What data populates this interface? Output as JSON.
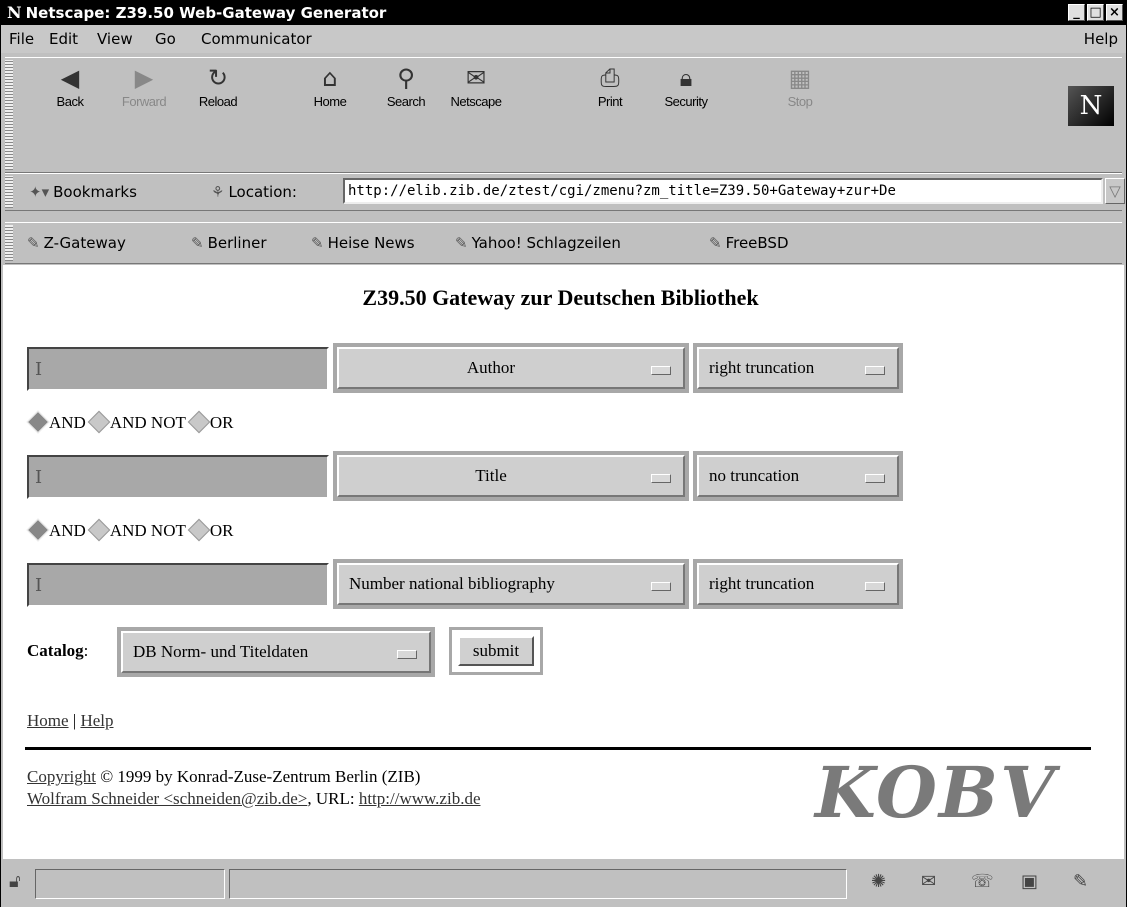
{
  "window": {
    "title": "Netscape: Z39.50 Web-Gateway Generator",
    "logo_letter": "N"
  },
  "menu": {
    "items": [
      "File",
      "Edit",
      "View",
      "Go",
      "Communicator"
    ],
    "help": "Help"
  },
  "nav": {
    "buttons": [
      {
        "label": "Back",
        "icon": "back-arrow-icon",
        "enabled": true
      },
      {
        "label": "Forward",
        "icon": "forward-arrow-icon",
        "enabled": false
      },
      {
        "label": "Reload",
        "icon": "reload-icon",
        "enabled": true
      },
      {
        "label": "Home",
        "icon": "home-icon",
        "enabled": true
      },
      {
        "label": "Search",
        "icon": "search-icon",
        "enabled": true
      },
      {
        "label": "Netscape",
        "icon": "netscape-icon",
        "enabled": true
      },
      {
        "label": "Print",
        "icon": "printer-icon",
        "enabled": true
      },
      {
        "label": "Security",
        "icon": "lock-icon",
        "enabled": true
      },
      {
        "label": "Stop",
        "icon": "stop-icon",
        "enabled": false
      }
    ],
    "brand_letter": "N"
  },
  "location": {
    "bookmarks_label": "Bookmarks",
    "location_label": "Location:",
    "url": "http://elib.zib.de/ztest/cgi/zmenu?zm_title=Z39.50+Gateway+zur+De"
  },
  "personal_toolbar": {
    "links": [
      "Z-Gateway",
      "Berliner",
      "Heise News",
      "Yahoo! Schlagzeilen",
      "FreeBSD"
    ]
  },
  "page": {
    "heading": "Z39.50 Gateway zur Deutschen Bibliothek",
    "rows": [
      {
        "field_value": "",
        "attribute": "Author",
        "truncation": "right truncation"
      },
      {
        "field_value": "",
        "attribute": "Title",
        "truncation": "no truncation"
      },
      {
        "field_value": "",
        "attribute": "Number national bibliography",
        "truncation": "right truncation"
      }
    ],
    "operators": {
      "and": "AND",
      "and_not": "AND NOT",
      "or": "OR",
      "selected": "AND"
    },
    "catalog_label": "Catalog",
    "catalog_colon": ":",
    "catalog_value": "DB Norm- und Titeldaten",
    "submit_label": "submit",
    "nav_home": "Home",
    "nav_sep": "|",
    "nav_help": "Help",
    "copyright_link": "Copyright",
    "copyright_text": " © 1999 by Konrad-Zuse-Zentrum Berlin (ZIB)",
    "author_link": "Wolfram Schneider <schneiden@zib.de>",
    "url_label": ", URL: ",
    "url_link": "http://www.zib.de",
    "logo_text": "KOBV"
  }
}
